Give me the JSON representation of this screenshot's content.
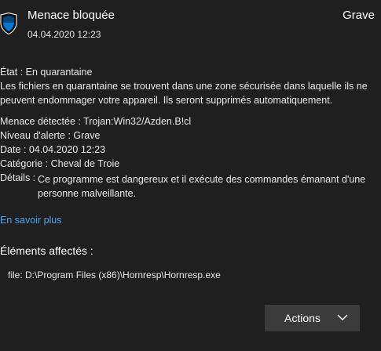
{
  "header": {
    "title": "Menace bloquée",
    "date": "04.04.2020 12:23",
    "severity": "Grave",
    "icon": "shield-icon"
  },
  "status": "État : En quarantaine",
  "description": "Les fichiers en quarantaine se trouvent dans une zone sécurisée dans laquelle ils ne peuvent endommager votre appareil. Ils seront supprimés automatiquement.",
  "details": {
    "threat": "Menace détectée :  Trojan:Win32/Azden.B!cl",
    "alert_level": "Niveau d'alerte :  Grave",
    "date": "Date :  04.04.2020 12:23",
    "category": "Catégorie :  Cheval de Troie",
    "details_label": "Détails :",
    "details_value": "Ce programme est dangereux et il exécute des commandes émanant d'une personne malveillante."
  },
  "learn_more": "En savoir plus",
  "affected": {
    "heading": "Éléments affectés :",
    "items": [
      "file: D:\\Program Files (x86)\\Hornresp\\Hornresp.exe"
    ]
  },
  "actions": {
    "label": "Actions",
    "icon": "chevron-down-icon"
  },
  "colors": {
    "background": "#1f1f1f",
    "link": "#4aa3ea",
    "button": "#3b3b3b",
    "shield": "#0078d7"
  }
}
